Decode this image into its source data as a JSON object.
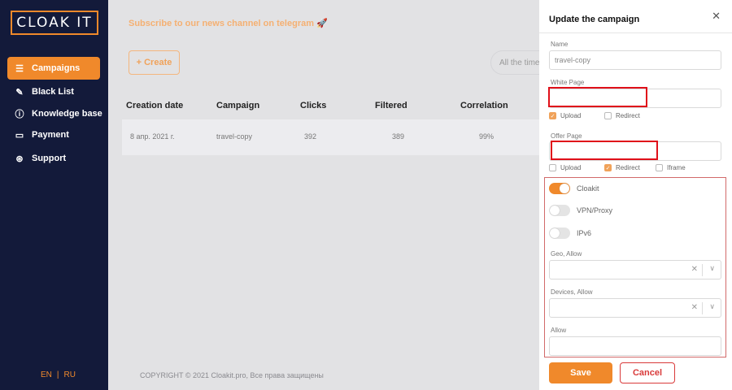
{
  "sidebar": {
    "logo": "CLOAK IT",
    "items": [
      {
        "label": "Campaigns",
        "icon": "☰"
      },
      {
        "label": "Black List",
        "icon": "✎"
      },
      {
        "label": "Knowledge base",
        "icon": "ⓘ"
      },
      {
        "label": "Payment",
        "icon": "▭"
      },
      {
        "label": "Support",
        "icon": "⊛"
      }
    ],
    "lang": {
      "en": "EN",
      "sep": "|",
      "ru": "RU"
    }
  },
  "main": {
    "telegram_text": "Subscribe to our news channel on telegram 🚀",
    "create_label": "+ Create",
    "time_filter": "All the time",
    "columns": [
      "Creation date",
      "Campaign",
      "Clicks",
      "Filtered",
      "Correlation"
    ],
    "rows": [
      {
        "date": "8 апр. 2021 г.",
        "campaign": "travel-copy",
        "clicks": "392",
        "filtered": "389",
        "correlation": "99%"
      }
    ],
    "copyright": "COPYRIGHT © 2021 Cloakit.pro, Все права защищены"
  },
  "panel": {
    "title": "Update the campaign",
    "close": "✕",
    "name_label": "Name",
    "name_value": "travel-copy",
    "white_page_label": "White Page",
    "white_upload": "Upload",
    "white_redirect": "Redirect",
    "offer_page_label": "Offer Page",
    "offer_upload": "Upload",
    "offer_redirect": "Redirect",
    "offer_iframe": "Iframe",
    "toggles": [
      {
        "label": "Cloakit",
        "on": true
      },
      {
        "label": "VPN/Proxy",
        "on": false
      },
      {
        "label": "IPv6",
        "on": false
      }
    ],
    "geo_label": "Geo, Allow",
    "devices_label": "Devices, Allow",
    "allow_label": "Allow",
    "save_label": "Save",
    "cancel_label": "Cancel"
  },
  "colors": {
    "accent": "#f0892b",
    "sidebar": "#131a3a",
    "highlight": "#e0101a"
  }
}
